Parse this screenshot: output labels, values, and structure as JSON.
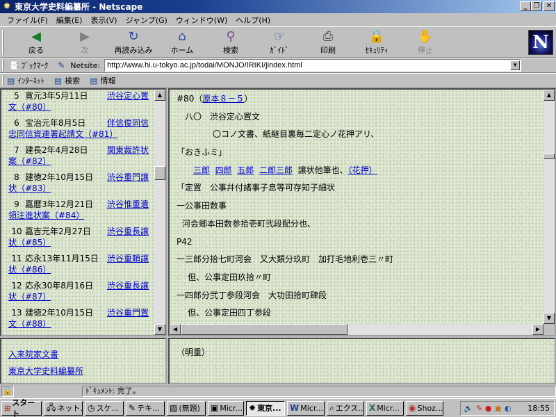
{
  "window": {
    "title": "東京大学史料編纂所 - Netscape"
  },
  "menu": [
    "ファイル(F)",
    "編集(E)",
    "表示(V)",
    "ジャンプ(G)",
    "ウィンドウ(W)",
    "ヘルプ(H)"
  ],
  "nav": [
    {
      "label": "戻る",
      "icon": "back-icon",
      "glyph": "◀",
      "enabled": true
    },
    {
      "label": "次",
      "icon": "forward-icon",
      "glyph": "▶",
      "enabled": false
    },
    {
      "label": "再読み込み",
      "icon": "reload-icon",
      "glyph": "↻",
      "enabled": true
    },
    {
      "label": "ホーム",
      "icon": "home-icon",
      "glyph": "⌂",
      "enabled": true
    },
    {
      "label": "検索",
      "icon": "search-icon",
      "glyph": "⚲",
      "enabled": true
    },
    {
      "label": "ｶﾞｲﾄﾞ",
      "icon": "guide-icon",
      "glyph": "☞",
      "enabled": true
    },
    {
      "label": "印刷",
      "icon": "print-icon",
      "glyph": "⎙",
      "enabled": true
    },
    {
      "label": "ｾｷｭﾘﾃｨ",
      "icon": "security-lock-icon",
      "glyph": "🔒",
      "enabled": true
    },
    {
      "label": "停止",
      "icon": "stop-icon",
      "glyph": "✋",
      "enabled": false
    }
  ],
  "location": {
    "bookmark_label": "ﾌﾞｯｸﾏｰｸ",
    "netsite_label": "Netsite:",
    "url": "http://www.hi.u-tokyo.ac.jp/todai/MONJO/IRIKI/jindex.html"
  },
  "personal": [
    {
      "label": "ｲﾝﾀｰﾈｯﾄ",
      "icon": "internet-icon"
    },
    {
      "label": "検索",
      "icon": "lookup-icon"
    },
    {
      "label": "情報",
      "icon": "info-icon"
    }
  ],
  "documents": [
    {
      "num": "5",
      "date": "寛元3年5月11日",
      "title": "渋谷定心置文（#80）"
    },
    {
      "num": "6",
      "date": "宝治元年8月5日",
      "title": "伴信俊同信忠同信資連署起請文（#81）"
    },
    {
      "num": "7",
      "date": "建長2年4月28日",
      "title": "関東裁許状案（#82）"
    },
    {
      "num": "8",
      "date": "建徳2年10月15日",
      "title": "渋谷重門譲状（#83）"
    },
    {
      "num": "9",
      "date": "嘉暦3年12月21日",
      "title": "渋谷惟重遺領注進状案（#84）"
    },
    {
      "num": "10",
      "date": "嘉吉元年2月27日",
      "title": "渋谷重長譲状（#85）"
    },
    {
      "num": "11",
      "date": "応永13年11月15日",
      "title": "渋谷重頼譲状（#86）"
    },
    {
      "num": "12",
      "date": "応永30年8月16日",
      "title": "渋谷重長譲状（#87）"
    },
    {
      "num": "13",
      "date": "建徳2年10月15日",
      "title": "渋谷重門置文（#88）"
    }
  ],
  "content": {
    "header_num": "#80（",
    "header_link": "原本８－５",
    "header_close": "）",
    "line1": "八〇　渋谷定心置文",
    "line2": "〇コノ文書、紙継目裏毎二定心ノ花押アリ、",
    "line3": "「おきふミ」",
    "names": [
      "三郎",
      "四郎",
      "五郎",
      "二郎三郎"
    ],
    "line4_text": "譲状他筆也、",
    "line4_link": "（花押）",
    "line5": "「定置　公事幷付諸事子息等可存知子細状",
    "line6": "一公事田数事",
    "line7": "河会郷本田数参拾壱町弐段配分也、",
    "line8": "P42",
    "line9": "一三郎分拾七町河会　又大類分玖町　加打毛地利壱三〃町",
    "line10": "但、公事定田玖拾〃町",
    "line11": "一四郎分弐丁参段河会　大功田拾町肆段",
    "line12": "但、公事定田四丁参段"
  },
  "bottom_left": {
    "link1": "入来院家文書",
    "link2": "東京大学史料編纂所"
  },
  "bottom_right": {
    "text": "（明重）"
  },
  "status": {
    "text": "ﾄﾞｷｭﾒﾝﾄ: 完了。"
  },
  "taskbar": {
    "start": "スタート",
    "tasks": [
      {
        "label": "ネット...",
        "icon": "network-icon",
        "glyph": "🖧",
        "active": false
      },
      {
        "label": "スケ...",
        "icon": "schedule-icon",
        "glyph": "◷",
        "active": false
      },
      {
        "label": "テキ...",
        "icon": "text-editor-icon",
        "glyph": "✎",
        "active": false
      },
      {
        "label": "(無題)",
        "icon": "paint-icon",
        "glyph": "▨",
        "active": false
      },
      {
        "label": "Micr...",
        "icon": "app-icon",
        "glyph": "▣",
        "active": false
      },
      {
        "label": "東京...",
        "icon": "netscape-icon",
        "glyph": "✹",
        "active": true
      },
      {
        "label": "Micr...",
        "icon": "word-icon",
        "glyph": "W",
        "active": false
      },
      {
        "label": "エクス...",
        "icon": "explorer-icon",
        "glyph": "⌕",
        "active": false
      },
      {
        "label": "Micr...",
        "icon": "excel-icon",
        "glyph": "X",
        "active": false
      },
      {
        "label": "Shoz...",
        "icon": "shoz-icon",
        "glyph": "◉",
        "active": false
      }
    ],
    "clock": "18:55"
  }
}
